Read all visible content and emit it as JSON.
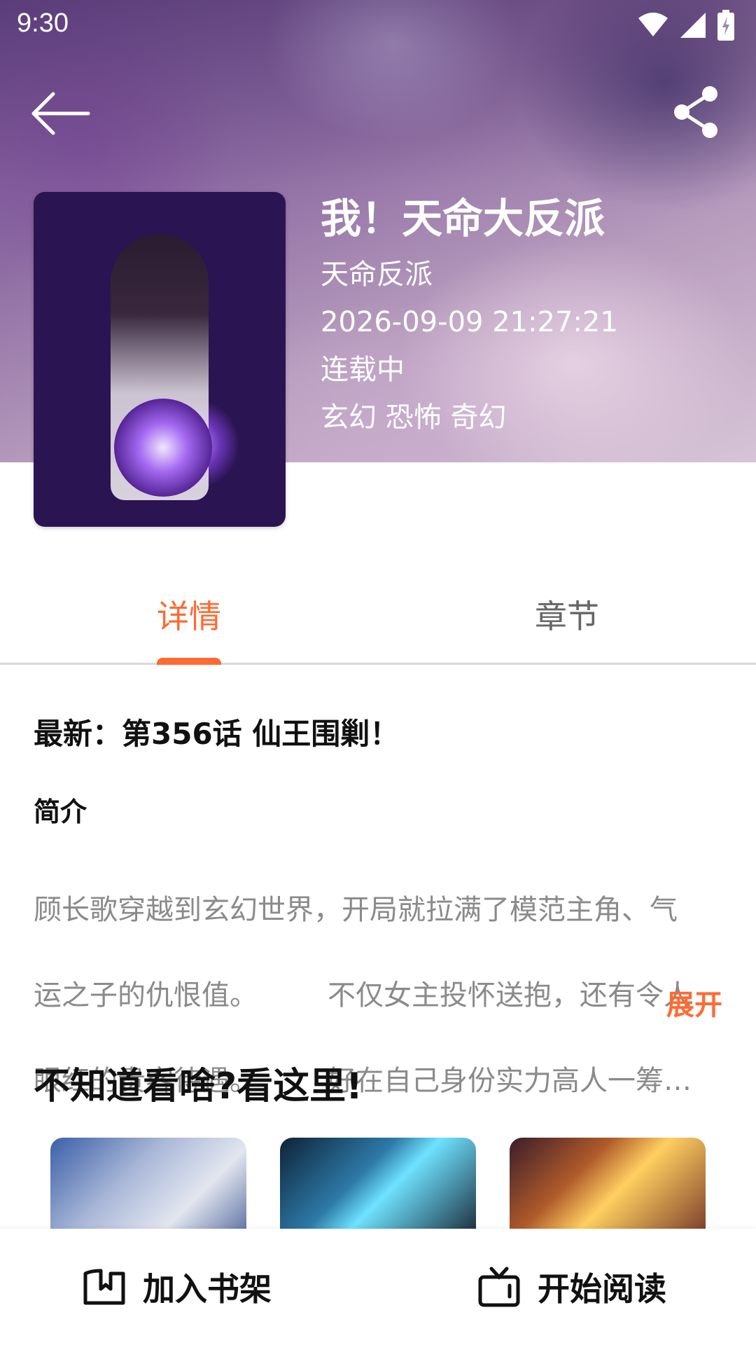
{
  "status_bar": {
    "time": "9:30"
  },
  "book": {
    "title": "我！天命大反派",
    "author": "天命反派",
    "updated": "2026-09-09 21:27:21",
    "status": "连载中",
    "genres": "玄幻 恐怖 奇幻"
  },
  "tabs": [
    {
      "label": "详情",
      "active": true
    },
    {
      "label": "章节",
      "active": false
    }
  ],
  "details": {
    "latest": "最新：第356话 仙王围剿！",
    "intro_label": "简介",
    "intro_lines": [
      "顾长歌穿越到玄幻世界，开局就拉满了模范主角、气",
      "运之子的仇恨值。　　　不仅女主投怀送抱，还有令人",
      "眼红的贵客待遇。　　　好在自己身份实力高人一筹…"
    ],
    "expand_label": "展开"
  },
  "recommend": {
    "title": "不知道看啥?看这里!"
  },
  "bottom_bar": {
    "add_shelf_label": "加入书架",
    "start_reading_label": "开始阅读"
  },
  "colors": {
    "accent": "#ff6a33"
  },
  "icons": [
    "back-arrow-icon",
    "share-icon",
    "wifi-icon",
    "signal-icon",
    "battery-icon",
    "bookshelf-icon",
    "tv-icon"
  ]
}
